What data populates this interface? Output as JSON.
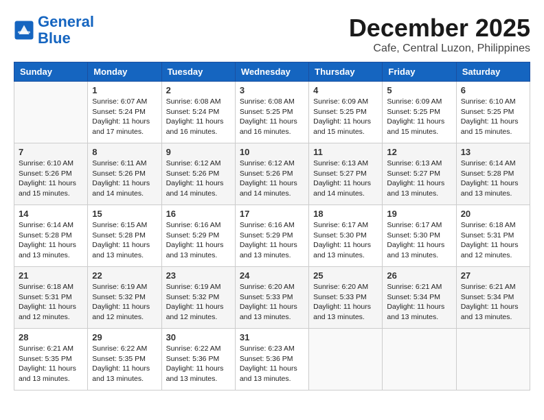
{
  "header": {
    "logo_line1": "General",
    "logo_line2": "Blue",
    "month": "December 2025",
    "location": "Cafe, Central Luzon, Philippines"
  },
  "weekdays": [
    "Sunday",
    "Monday",
    "Tuesday",
    "Wednesday",
    "Thursday",
    "Friday",
    "Saturday"
  ],
  "weeks": [
    [
      {
        "day": "",
        "sunrise": "",
        "sunset": "",
        "daylight": ""
      },
      {
        "day": "1",
        "sunrise": "6:07 AM",
        "sunset": "5:24 PM",
        "daylight": "11 hours and 17 minutes."
      },
      {
        "day": "2",
        "sunrise": "6:08 AM",
        "sunset": "5:24 PM",
        "daylight": "11 hours and 16 minutes."
      },
      {
        "day": "3",
        "sunrise": "6:08 AM",
        "sunset": "5:25 PM",
        "daylight": "11 hours and 16 minutes."
      },
      {
        "day": "4",
        "sunrise": "6:09 AM",
        "sunset": "5:25 PM",
        "daylight": "11 hours and 15 minutes."
      },
      {
        "day": "5",
        "sunrise": "6:09 AM",
        "sunset": "5:25 PM",
        "daylight": "11 hours and 15 minutes."
      },
      {
        "day": "6",
        "sunrise": "6:10 AM",
        "sunset": "5:25 PM",
        "daylight": "11 hours and 15 minutes."
      }
    ],
    [
      {
        "day": "7",
        "sunrise": "6:10 AM",
        "sunset": "5:26 PM",
        "daylight": "11 hours and 15 minutes."
      },
      {
        "day": "8",
        "sunrise": "6:11 AM",
        "sunset": "5:26 PM",
        "daylight": "11 hours and 14 minutes."
      },
      {
        "day": "9",
        "sunrise": "6:12 AM",
        "sunset": "5:26 PM",
        "daylight": "11 hours and 14 minutes."
      },
      {
        "day": "10",
        "sunrise": "6:12 AM",
        "sunset": "5:26 PM",
        "daylight": "11 hours and 14 minutes."
      },
      {
        "day": "11",
        "sunrise": "6:13 AM",
        "sunset": "5:27 PM",
        "daylight": "11 hours and 14 minutes."
      },
      {
        "day": "12",
        "sunrise": "6:13 AM",
        "sunset": "5:27 PM",
        "daylight": "11 hours and 13 minutes."
      },
      {
        "day": "13",
        "sunrise": "6:14 AM",
        "sunset": "5:28 PM",
        "daylight": "11 hours and 13 minutes."
      }
    ],
    [
      {
        "day": "14",
        "sunrise": "6:14 AM",
        "sunset": "5:28 PM",
        "daylight": "11 hours and 13 minutes."
      },
      {
        "day": "15",
        "sunrise": "6:15 AM",
        "sunset": "5:28 PM",
        "daylight": "11 hours and 13 minutes."
      },
      {
        "day": "16",
        "sunrise": "6:16 AM",
        "sunset": "5:29 PM",
        "daylight": "11 hours and 13 minutes."
      },
      {
        "day": "17",
        "sunrise": "6:16 AM",
        "sunset": "5:29 PM",
        "daylight": "11 hours and 13 minutes."
      },
      {
        "day": "18",
        "sunrise": "6:17 AM",
        "sunset": "5:30 PM",
        "daylight": "11 hours and 13 minutes."
      },
      {
        "day": "19",
        "sunrise": "6:17 AM",
        "sunset": "5:30 PM",
        "daylight": "11 hours and 13 minutes."
      },
      {
        "day": "20",
        "sunrise": "6:18 AM",
        "sunset": "5:31 PM",
        "daylight": "11 hours and 12 minutes."
      }
    ],
    [
      {
        "day": "21",
        "sunrise": "6:18 AM",
        "sunset": "5:31 PM",
        "daylight": "11 hours and 12 minutes."
      },
      {
        "day": "22",
        "sunrise": "6:19 AM",
        "sunset": "5:32 PM",
        "daylight": "11 hours and 12 minutes."
      },
      {
        "day": "23",
        "sunrise": "6:19 AM",
        "sunset": "5:32 PM",
        "daylight": "11 hours and 12 minutes."
      },
      {
        "day": "24",
        "sunrise": "6:20 AM",
        "sunset": "5:33 PM",
        "daylight": "11 hours and 13 minutes."
      },
      {
        "day": "25",
        "sunrise": "6:20 AM",
        "sunset": "5:33 PM",
        "daylight": "11 hours and 13 minutes."
      },
      {
        "day": "26",
        "sunrise": "6:21 AM",
        "sunset": "5:34 PM",
        "daylight": "11 hours and 13 minutes."
      },
      {
        "day": "27",
        "sunrise": "6:21 AM",
        "sunset": "5:34 PM",
        "daylight": "11 hours and 13 minutes."
      }
    ],
    [
      {
        "day": "28",
        "sunrise": "6:21 AM",
        "sunset": "5:35 PM",
        "daylight": "11 hours and 13 minutes."
      },
      {
        "day": "29",
        "sunrise": "6:22 AM",
        "sunset": "5:35 PM",
        "daylight": "11 hours and 13 minutes."
      },
      {
        "day": "30",
        "sunrise": "6:22 AM",
        "sunset": "5:36 PM",
        "daylight": "11 hours and 13 minutes."
      },
      {
        "day": "31",
        "sunrise": "6:23 AM",
        "sunset": "5:36 PM",
        "daylight": "11 hours and 13 minutes."
      },
      {
        "day": "",
        "sunrise": "",
        "sunset": "",
        "daylight": ""
      },
      {
        "day": "",
        "sunrise": "",
        "sunset": "",
        "daylight": ""
      },
      {
        "day": "",
        "sunrise": "",
        "sunset": "",
        "daylight": ""
      }
    ]
  ],
  "labels": {
    "sunrise_prefix": "Sunrise: ",
    "sunset_prefix": "Sunset: ",
    "daylight_prefix": "Daylight: "
  }
}
